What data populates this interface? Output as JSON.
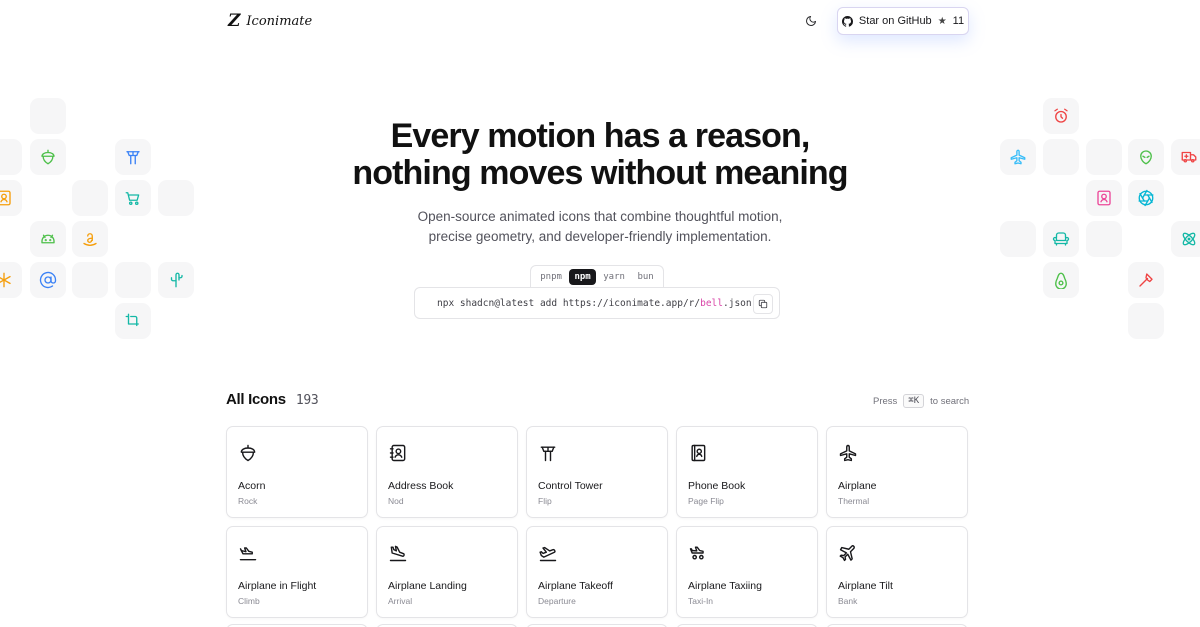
{
  "header": {
    "logo_mark": "Z",
    "logo_text": "Iconimate",
    "github_label": "Star on GitHub",
    "github_star": "★",
    "github_stars": "11"
  },
  "hero": {
    "title_line1": "Every motion has a reason,",
    "title_line2": "nothing moves without meaning",
    "subtitle_line1": "Open-source animated icons that combine thoughtful motion,",
    "subtitle_line2": "precise geometry, and developer-friendly implementation."
  },
  "install": {
    "tabs": [
      "pnpm",
      "npm",
      "yarn",
      "bun"
    ],
    "active_tab": "npm",
    "command_prefix": "npx shadcn@latest add https://iconimate.app/r/",
    "command_highlight": "bell",
    "command_suffix": ".json"
  },
  "all_icons": {
    "title": "All Icons",
    "count": "193",
    "search_hint_prefix": "Press",
    "search_hint_key": "⌘K",
    "search_hint_suffix": "to search"
  },
  "icons": [
    {
      "name": "Acorn",
      "animation": "Rock",
      "icon": "acorn-icon"
    },
    {
      "name": "Address Book",
      "animation": "Nod",
      "icon": "address-book-icon"
    },
    {
      "name": "Control Tower",
      "animation": "Flip",
      "icon": "control-tower-icon"
    },
    {
      "name": "Phone Book",
      "animation": "Page Flip",
      "icon": "phone-book-icon"
    },
    {
      "name": "Airplane",
      "animation": "Thermal",
      "icon": "airplane-icon"
    },
    {
      "name": "Airplane in Flight",
      "animation": "Climb",
      "icon": "airplane-in-flight-icon"
    },
    {
      "name": "Airplane Landing",
      "animation": "Arrival",
      "icon": "airplane-landing-icon"
    },
    {
      "name": "Airplane Takeoff",
      "animation": "Departure",
      "icon": "airplane-takeoff-icon"
    },
    {
      "name": "Airplane Taxiing",
      "animation": "Taxi-In",
      "icon": "airplane-taxiing-icon"
    },
    {
      "name": "Airplane Tilt",
      "animation": "Bank",
      "icon": "airplane-tilt-icon"
    }
  ],
  "colors": {
    "green": "#4ec04a",
    "blue": "#3b82f6",
    "teal": "#14b8a6",
    "orange": "#f59e0b",
    "red": "#ef4444",
    "pink": "#ec4899",
    "cyan": "#06b6d4",
    "sky": "#38bdf8"
  }
}
